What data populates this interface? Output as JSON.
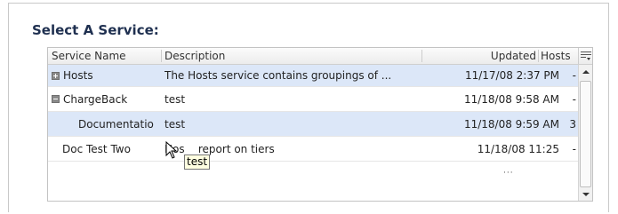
{
  "title": "Select A Service:",
  "columns": {
    "name": "Service Name",
    "description": "Description",
    "updated": "Updated",
    "hosts": "Hosts"
  },
  "rows": [
    {
      "name": "Hosts",
      "toggle": "plus",
      "description": "The Hosts service contains groupings of ...",
      "updated": "11/17/08 2:37 PM",
      "hosts": "-"
    },
    {
      "name": "ChargeBack",
      "toggle": "minus",
      "description": "test",
      "updated": "11/18/08 9:58 AM",
      "hosts": "-"
    },
    {
      "name": "Documentatio",
      "toggle": "none",
      "description": "test",
      "updated": "11/18/08 9:59 AM",
      "hosts": "3"
    },
    {
      "name": "Doc Test Two",
      "toggle": "none",
      "description": "Hos    report on tiers",
      "updated": "11/18/08 11:25",
      "hosts": "-"
    }
  ],
  "tooltip": "test",
  "icons": {
    "columns_menu": "column-chooser-icon",
    "expand": "plus-box-icon",
    "collapse": "minus-box-icon",
    "scroll_up": "arrow-up-icon",
    "scroll_down": "arrow-down-icon",
    "cursor": "mouse-pointer-icon"
  },
  "colors": {
    "title": "#1f3050",
    "row_highlight": "#dce7f8",
    "tooltip_bg": "#ffffe1"
  }
}
